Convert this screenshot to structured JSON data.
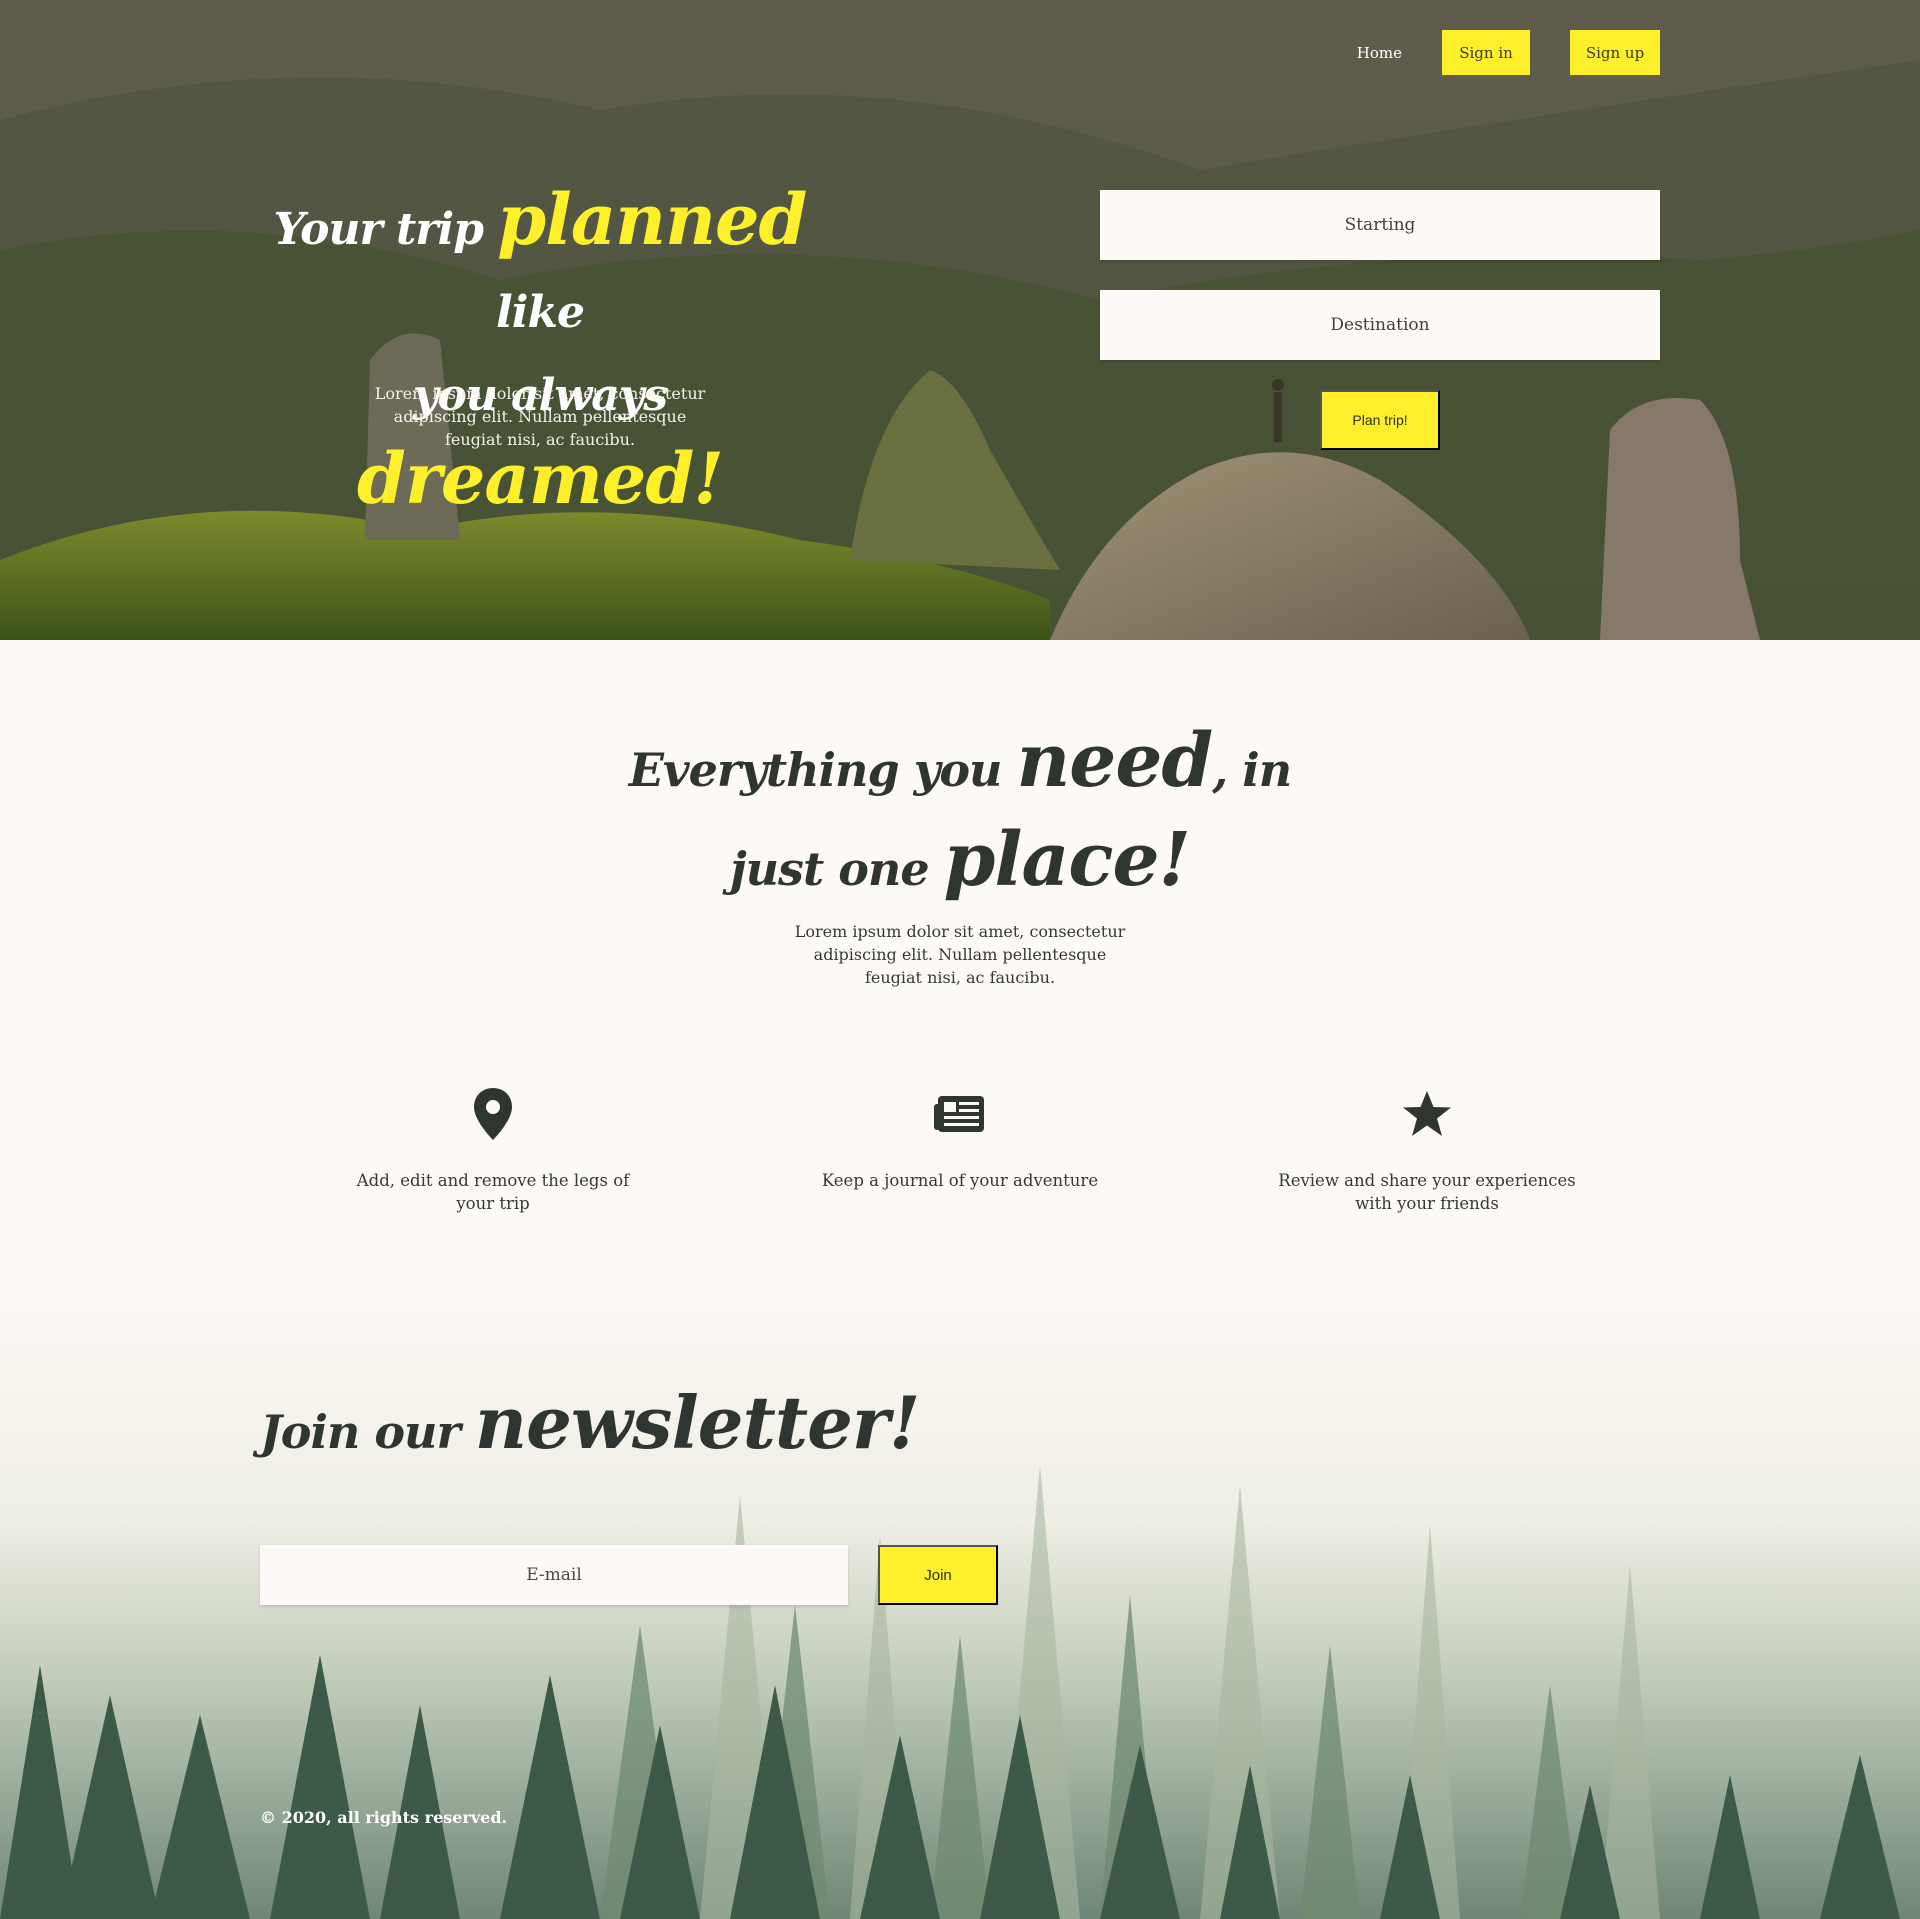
{
  "nav": {
    "home": "Home",
    "sign_in": "Sign in",
    "sign_up": "Sign up"
  },
  "hero": {
    "title_part1": "Your trip ",
    "title_highlight1": "planned",
    "title_part2": " like",
    "title_part3": "you always ",
    "title_highlight2": "dreamed!",
    "text": "Lorem ipsum dolor sit amet, consectetur adipiscing elit. Nullam pellentesque feugiat nisi, ac faucibu."
  },
  "planner": {
    "starting_placeholder": "Starting",
    "destination_placeholder": "Destination",
    "plan_button": "Plan trip!"
  },
  "features": {
    "title_part1": "Everything you ",
    "title_highlight1": "need",
    "title_part2": ", in",
    "title_part3": "just one ",
    "title_highlight2": "place!",
    "text": "Lorem ipsum dolor sit amet, consectetur adipiscing elit. Nullam pellentesque feugiat nisi, ac faucibu.",
    "items": [
      {
        "icon": "map-marker-icon",
        "label": "Add, edit and remove the legs of your trip"
      },
      {
        "icon": "newspaper-icon",
        "label": "Keep a journal of your adventure"
      },
      {
        "icon": "star-icon",
        "label": "Review and share your experiences with your friends"
      }
    ]
  },
  "newsletter": {
    "title_part1": "Join our ",
    "title_highlight": "newsletter!",
    "email_placeholder": "E-mail",
    "join_button": "Join"
  },
  "footer": {
    "copyright": "© 2020, all rights reserved."
  },
  "colors": {
    "accent": "#fdf02a",
    "text_dark": "#2f3530",
    "background": "#fdf9f6"
  }
}
